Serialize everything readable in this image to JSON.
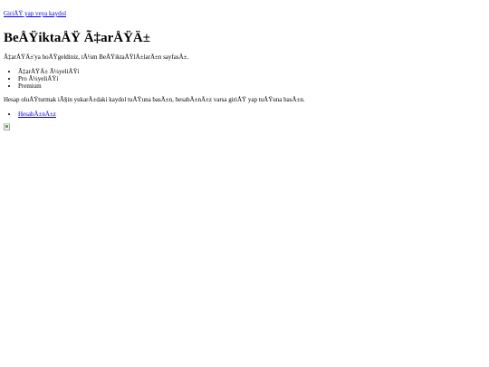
{
  "header": {
    "login_link": "GiriÅŸ yap veya kaydol"
  },
  "page_title": "BeÅŸiktaÅŸ Ã‡arÅŸÄ±",
  "welcome_text": "Ã‡arÅŸÄ±'ya hoÅŸgeldiniz, tÃ¼m BeÅŸiktaÅŸlÄ±larÄ±n sayfasÄ±.",
  "membership_list": [
    "Ã‡arÅŸÄ± Ã¼yeliÄŸi",
    "Pro Ã¼yeliÄŸi",
    "Premium"
  ],
  "info_text": "Hesap oluÅŸturmak iÃ§in yukarÄ±daki kaydol tuÅŸuna basÄ±n, hesabÄ±nÄ±z varsa giriÅŸ yap tuÅŸuna basÄ±n.",
  "account_list": [
    "HesabÄ±nÄ±z"
  ]
}
